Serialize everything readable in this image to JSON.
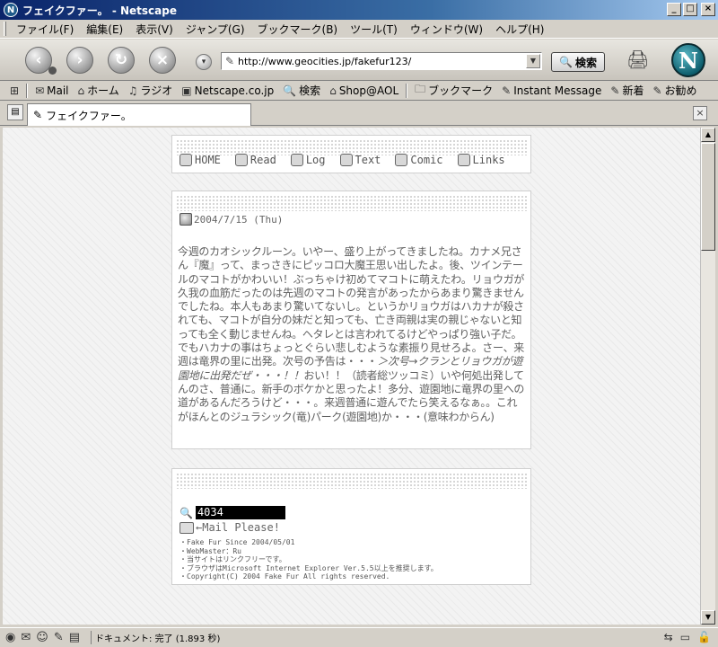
{
  "window": {
    "title": "フェイクファー。 - Netscape",
    "minimize": "_",
    "maximize": "□",
    "close": "×"
  },
  "menu": [
    "ファイル(F)",
    "編集(E)",
    "表示(V)",
    "ジャンプ(G)",
    "ブックマーク(B)",
    "ツール(T)",
    "ウィンドウ(W)",
    "ヘルプ(H)"
  ],
  "navbar": {
    "url": "http://www.geocities.jp/fakefur123/",
    "search_label": "検索",
    "icons": {
      "back": "back-arrow-icon",
      "forward": "forward-arrow-icon",
      "reload": "reload-icon",
      "stop": "stop-icon"
    }
  },
  "personal_toolbar": [
    "Mail",
    "ホーム",
    "ラジオ",
    "Netscape.co.jp",
    "検索",
    "Shop@AOL",
    "ブックマーク",
    "Instant Message",
    "新着",
    "お勧め"
  ],
  "tab": {
    "title": "フェイクファー。"
  },
  "site": {
    "nav": [
      "HOME",
      "Read",
      "Log",
      "Text",
      "Comic",
      "Links"
    ],
    "post": {
      "date": "2004/7/15 (Thu)",
      "body_pre": "今週のカオシックルーン。いやー、盛り上がってきましたね。カナメ兄さん『魔』って、まっさきにピッコロ大魔王思い出したよ。後、ツインテールのマコトがかわいい！ぶっちゃけ初めてマコトに萌えたわ。リョウガが久我の血筋だったのは先週のマコトの発言があったからあまり驚きませんでしたね。本人もあまり驚いてないし。というかリョウガはハカナが殺されても、マコトが自分の妹だと知っても、亡き両親は実の親じゃないと知っても全く動じませんね。ヘタレとは言われてるけどやっぱり強い子だ。でもハカナの事はちょっとぐらい悲しむような素振り見せろよ。さー、来週は竜界の里に出発。次号の予告は・・・",
      "body_italic": "＞次号→クランとリョウガが遊園地に出発だぜ・・・！！",
      "body_post": "おい！！（読者総ツッコミ）いや何処出発してんのさ、普通に。新手のボケかと思ったよ！多分、遊園地に竜界の里への道があるんだろうけど・・・。来週普通に遊んでたら笑えるなぁ。。これがほんとのジュラシック(竜)パーク(遊園地)か・・・(意味わからん)"
    },
    "footer": {
      "counter": "4034",
      "mail": "←Mail Please!",
      "credits": [
        "・Fake Fur Since 2004/05/01",
        "・WebMaster：Ru",
        "・当サイトはリンクフリーです。",
        "・ブラウザはMicrosoft Internet Explorer Ver.5.5以上を推奨します。",
        "・Copyright(C) 2004 Fake Fur All rights reserved."
      ]
    }
  },
  "status": {
    "text": "ドキュメント: 完了 (1.893 秒)"
  }
}
